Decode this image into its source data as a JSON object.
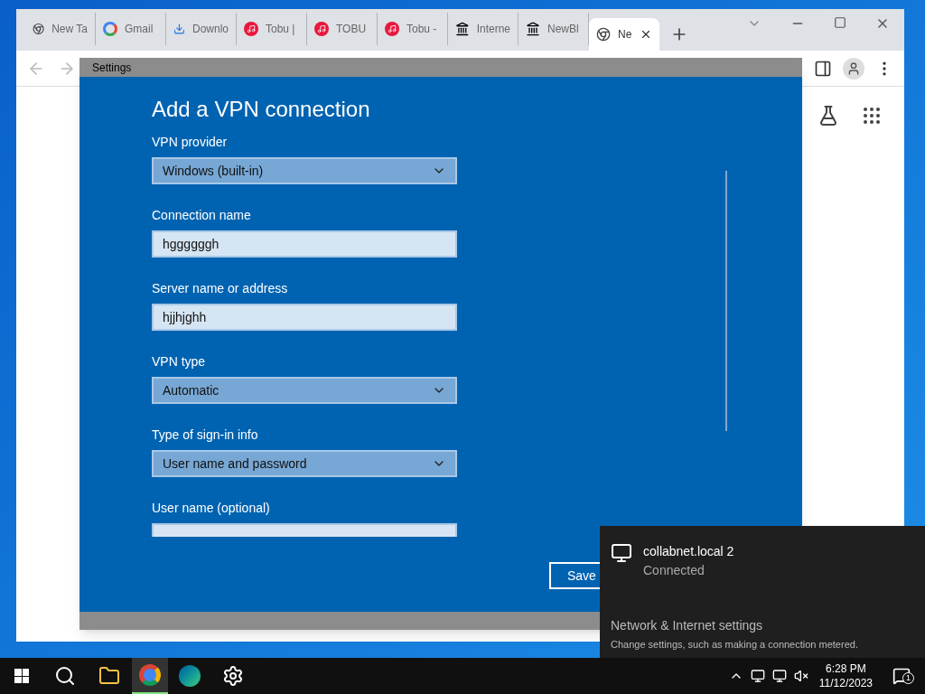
{
  "browser": {
    "tabs": [
      {
        "title": "New Ta",
        "kind": "chrome",
        "selected": false
      },
      {
        "title": "Gmail",
        "kind": "google",
        "selected": false
      },
      {
        "title": "Downlo",
        "kind": "download",
        "selected": false
      },
      {
        "title": "Tobu |",
        "kind": "music",
        "selected": false
      },
      {
        "title": "TOBU",
        "kind": "music",
        "selected": false
      },
      {
        "title": "Tobu -",
        "kind": "music",
        "selected": false
      },
      {
        "title": "Interne",
        "kind": "archive",
        "selected": false
      },
      {
        "title": "NewBl",
        "kind": "archive",
        "selected": false
      },
      {
        "title": "Ne",
        "kind": "chrome",
        "selected": true
      }
    ]
  },
  "settings": {
    "title": "Settings",
    "heading": "Add a VPN connection",
    "fields": [
      {
        "label": "VPN provider",
        "kind": "dropdown",
        "value": "Windows (built-in)"
      },
      {
        "label": "Connection name",
        "kind": "text",
        "value": "hggggggh"
      },
      {
        "label": "Server name or address",
        "kind": "text",
        "value": "hjjhjghh"
      },
      {
        "label": "VPN type",
        "kind": "dropdown",
        "value": "Automatic"
      },
      {
        "label": "Type of sign-in info",
        "kind": "dropdown",
        "value": "User name and password"
      },
      {
        "label": "User name (optional)",
        "kind": "text"
      }
    ],
    "save": "Save"
  },
  "flyout": {
    "network": "collabnet.local 2",
    "status": "Connected",
    "settings_title": "Network & Internet settings",
    "settings_hint": "Change settings, such as making a connection metered."
  },
  "taskbar": {
    "time": "6:28 PM",
    "date": "11/12/2023",
    "notifications": "1"
  }
}
